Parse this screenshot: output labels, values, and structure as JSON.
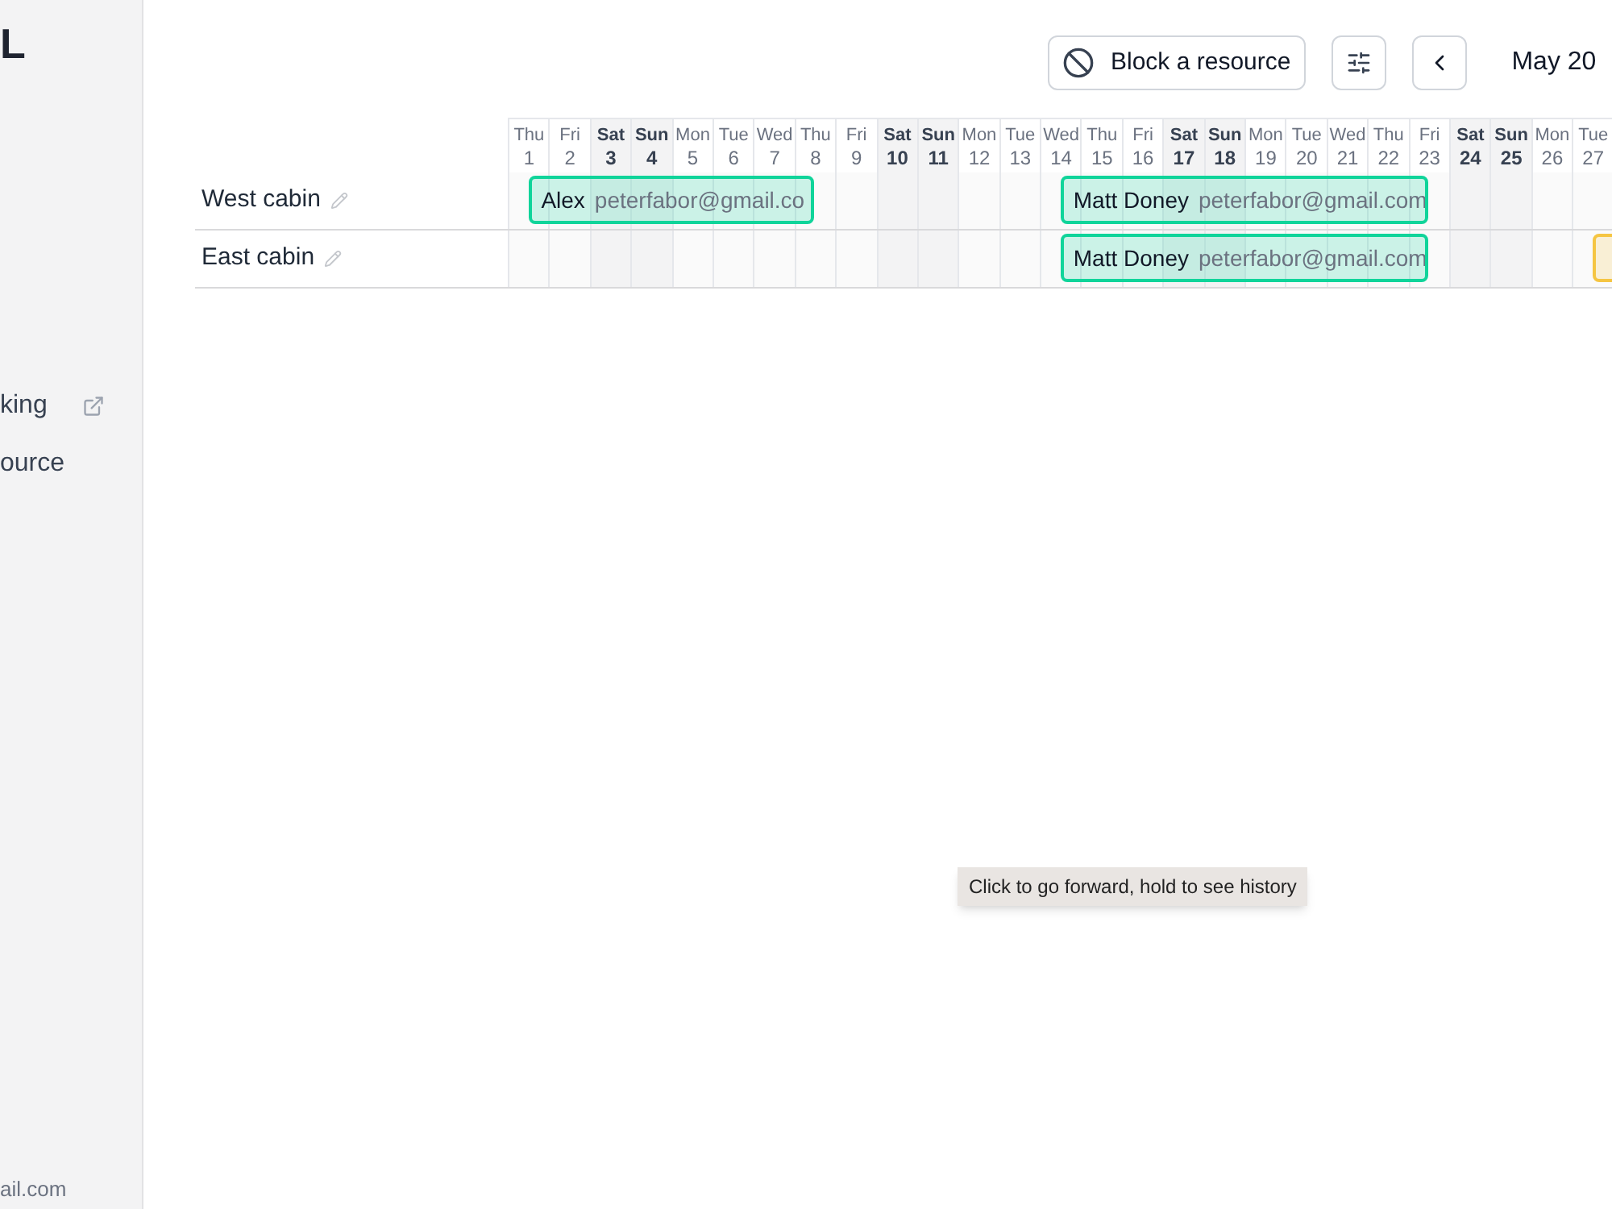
{
  "sidebar": {
    "logo": "L",
    "items": [
      {
        "label": "king",
        "external": true
      },
      {
        "label": "ource",
        "external": false
      }
    ],
    "account_email": "ail.com"
  },
  "toolbar": {
    "block_button": "Block a resource",
    "month": "May 20"
  },
  "days": [
    {
      "weekday": "Thu",
      "day": "1",
      "weekend": false
    },
    {
      "weekday": "Fri",
      "day": "2",
      "weekend": false
    },
    {
      "weekday": "Sat",
      "day": "3",
      "weekend": true
    },
    {
      "weekday": "Sun",
      "day": "4",
      "weekend": true
    },
    {
      "weekday": "Mon",
      "day": "5",
      "weekend": false
    },
    {
      "weekday": "Tue",
      "day": "6",
      "weekend": false
    },
    {
      "weekday": "Wed",
      "day": "7",
      "weekend": false
    },
    {
      "weekday": "Thu",
      "day": "8",
      "weekend": false
    },
    {
      "weekday": "Fri",
      "day": "9",
      "weekend": false
    },
    {
      "weekday": "Sat",
      "day": "10",
      "weekend": true
    },
    {
      "weekday": "Sun",
      "day": "11",
      "weekend": true
    },
    {
      "weekday": "Mon",
      "day": "12",
      "weekend": false
    },
    {
      "weekday": "Tue",
      "day": "13",
      "weekend": false
    },
    {
      "weekday": "Wed",
      "day": "14",
      "weekend": false
    },
    {
      "weekday": "Thu",
      "day": "15",
      "weekend": false
    },
    {
      "weekday": "Fri",
      "day": "16",
      "weekend": false
    },
    {
      "weekday": "Sat",
      "day": "17",
      "weekend": true
    },
    {
      "weekday": "Sun",
      "day": "18",
      "weekend": true
    },
    {
      "weekday": "Mon",
      "day": "19",
      "weekend": false
    },
    {
      "weekday": "Tue",
      "day": "20",
      "weekend": false
    },
    {
      "weekday": "Wed",
      "day": "21",
      "weekend": false
    },
    {
      "weekday": "Thu",
      "day": "22",
      "weekend": false
    },
    {
      "weekday": "Fri",
      "day": "23",
      "weekend": false
    },
    {
      "weekday": "Sat",
      "day": "24",
      "weekend": true
    },
    {
      "weekday": "Sun",
      "day": "25",
      "weekend": true
    },
    {
      "weekday": "Mon",
      "day": "26",
      "weekend": false
    },
    {
      "weekday": "Tue",
      "day": "27",
      "weekend": false
    }
  ],
  "resources": [
    {
      "name": "West cabin",
      "bookings": [
        {
          "guest": "Alex",
          "email": "peterfabor@gmail.co",
          "color": "#10d49a"
        },
        {
          "guest": "Matt Doney",
          "email": "peterfabor@gmail.com",
          "color": "#10d49a"
        }
      ]
    },
    {
      "name": "East cabin",
      "bookings": [
        {
          "guest": "Matt Doney",
          "email": "peterfabor@gmail.com",
          "color": "#10d49a"
        },
        {
          "color": "#f5c542"
        }
      ]
    }
  ],
  "tooltip": "Click to go forward, hold to see history"
}
